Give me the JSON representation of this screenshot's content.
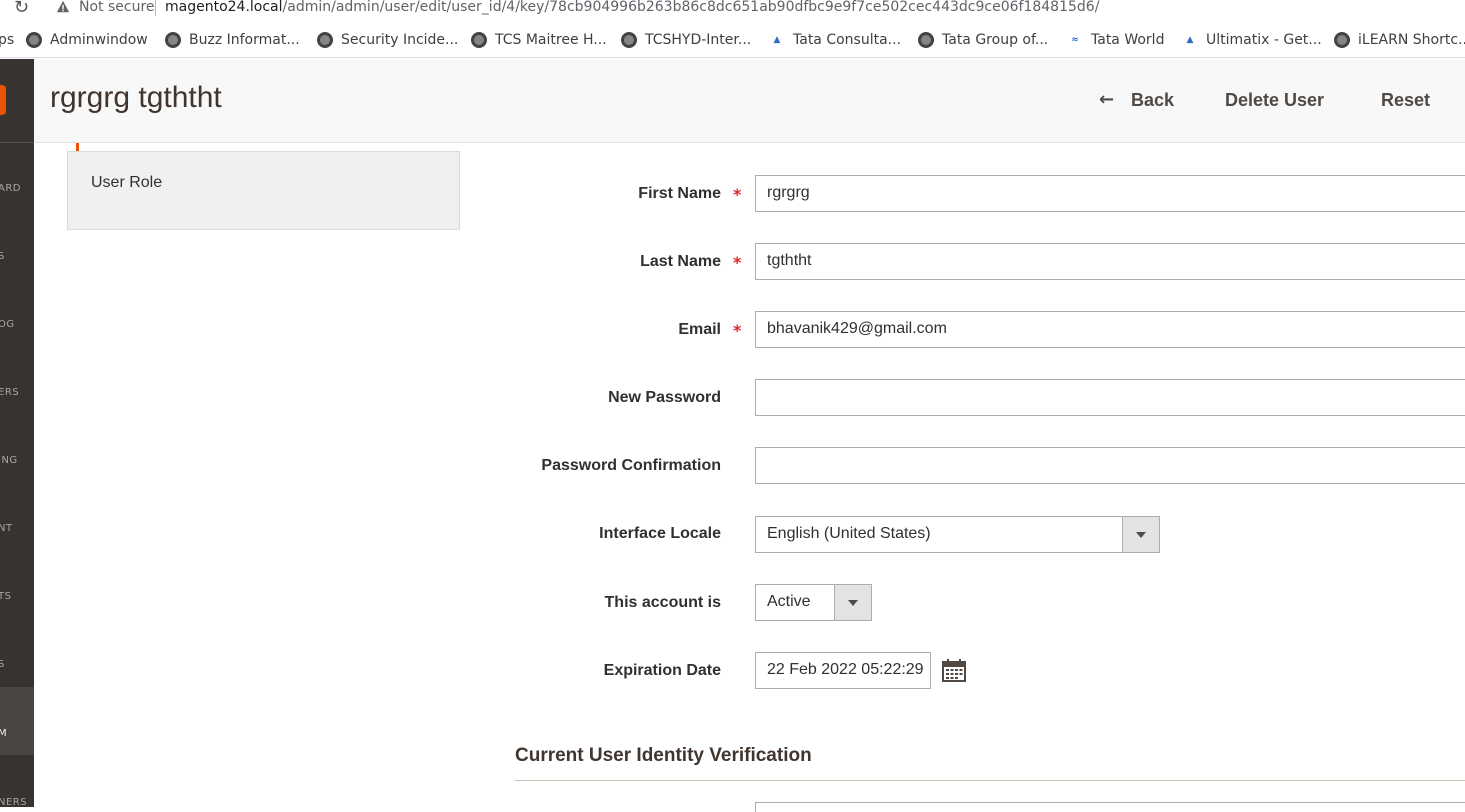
{
  "browser": {
    "not_secure": "Not secure",
    "url_host": "magento24.local",
    "url_path": "/admin/admin/user/edit/user_id/4/key/78cb904996b263b86c8dc651ab90dfbc9e9f7ce502cec443dc9ce06f184815d6/",
    "bookmarks": [
      {
        "label": "ps",
        "icon": "apps-icon"
      },
      {
        "label": "Adminwindow",
        "icon": "globe-icon"
      },
      {
        "label": "Buzz Informat...",
        "icon": "globe-icon"
      },
      {
        "label": "Security Incide...",
        "icon": "globe-icon"
      },
      {
        "label": "TCS Maitree H...",
        "icon": "globe-icon"
      },
      {
        "label": "TCSHYD-Inter...",
        "icon": "globe-icon"
      },
      {
        "label": "Tata Consulta...",
        "icon": "tata-icon"
      },
      {
        "label": "Tata Group of...",
        "icon": "globe-icon"
      },
      {
        "label": "Tata World",
        "icon": "tata-world-icon"
      },
      {
        "label": "Ultimatix - Get...",
        "icon": "tata-icon"
      },
      {
        "label": "iLEARN Shortc...",
        "icon": "globe-icon"
      }
    ]
  },
  "admin_nav": {
    "items": [
      "ARD",
      "S",
      "OG",
      "ERS",
      "ING",
      "NT",
      "TS",
      "S",
      "M",
      "NERS"
    ]
  },
  "header": {
    "title": "rgrgrg tgththt",
    "back_label": "Back",
    "delete_label": "Delete User",
    "reset_label": "Reset"
  },
  "tabs": {
    "user_role": "User Role"
  },
  "form": {
    "first_name_label": "First Name",
    "first_name_value": "rgrgrg",
    "last_name_label": "Last Name",
    "last_name_value": "tgththt",
    "email_label": "Email",
    "email_value": "bhavanik429@gmail.com",
    "new_password_label": "New Password",
    "new_password_value": "",
    "password_confirm_label": "Password Confirmation",
    "password_confirm_value": "",
    "locale_label": "Interface Locale",
    "locale_value": "English (United States)",
    "account_label": "This account is",
    "account_value": "Active",
    "expiration_label": "Expiration Date",
    "expiration_value": "22 Feb 2022 05:22:29",
    "required_mark": "*"
  },
  "verification": {
    "title": "Current User Identity Verification"
  },
  "colors": {
    "accent": "#eb5202",
    "required": "#e22626",
    "nav_bg": "#373330",
    "header_bg": "#f8f8f8"
  }
}
